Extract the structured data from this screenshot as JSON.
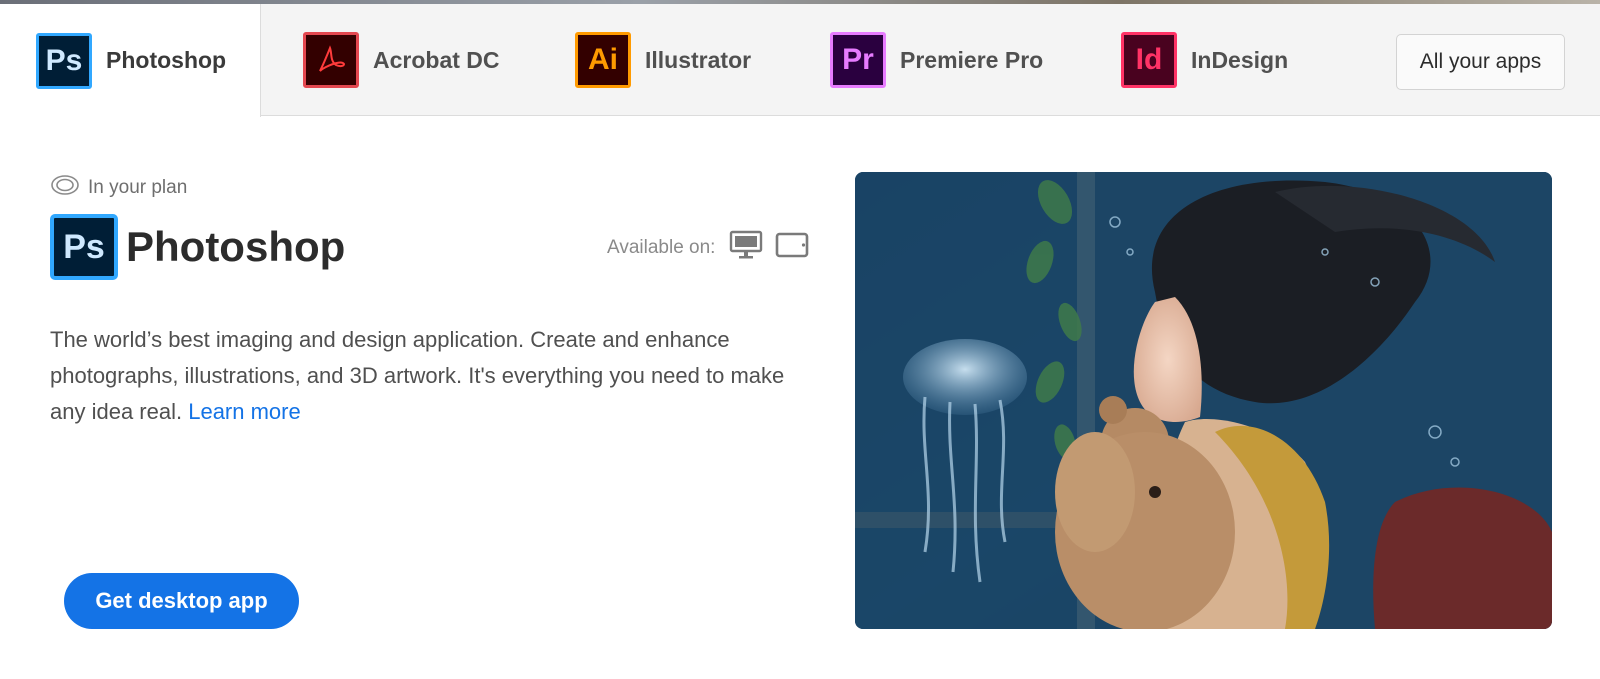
{
  "tabs": [
    {
      "label": "Photoshop",
      "abbr": "Ps",
      "active": true,
      "color": "#31a8ff"
    },
    {
      "label": "Acrobat DC",
      "abbr": "",
      "active": false,
      "color": "#e34850"
    },
    {
      "label": "Illustrator",
      "abbr": "Ai",
      "active": false,
      "color": "#ff9a00"
    },
    {
      "label": "Premiere Pro",
      "abbr": "Pr",
      "active": false,
      "color": "#e77cff"
    },
    {
      "label": "InDesign",
      "abbr": "Id",
      "active": false,
      "color": "#ff3366"
    }
  ],
  "all_apps_label": "All your apps",
  "product": {
    "plan_label": "In your plan",
    "icon_abbr": "Ps",
    "title": "Photoshop",
    "available_label": "Available on:",
    "platforms": [
      "desktop-icon",
      "tablet-icon"
    ],
    "description": "The world’s best imaging and design application. Create and enhance photographs, illustrations, and 3D artwork. It's everything you need to make any idea real.",
    "learn_more": "Learn more",
    "cta_label": "Get desktop app"
  },
  "colors": {
    "accent": "#1473e6",
    "ps_blue": "#31a8ff",
    "ps_bg": "#001e36"
  }
}
